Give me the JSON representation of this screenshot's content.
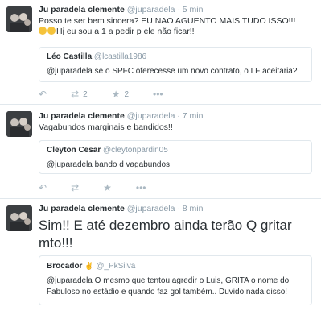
{
  "tweets": [
    {
      "author": "Ju paradela clemente",
      "handle": "@juparadela",
      "sep": "·",
      "time": "5 min",
      "text_line1": "Posso te ser bem sincera? EU NAO AGUENTO MAIS TUDO ISSO!!!",
      "text_line2": "Hj eu sou a 1 a pedir p ele não ficar!!",
      "quote": {
        "author": "Léo Castilla",
        "handle": "@lcastilla1986",
        "text": "@juparadela se o SPFC oferecesse um novo contrato, o LF aceitaria?"
      },
      "retweet_count": "2",
      "favorite_count": "2"
    },
    {
      "author": "Ju paradela clemente",
      "handle": "@juparadela",
      "sep": "·",
      "time": "7 min",
      "text_line1": "Vagabundos marginais e bandidos!!",
      "quote": {
        "author": "Cleyton Cesar",
        "handle": "@cleytonpardin05",
        "text": "@juparadela bando d vagabundos"
      }
    },
    {
      "author": "Ju paradela clemente",
      "handle": "@juparadela",
      "sep": "·",
      "time": "8 min",
      "text_line1": "Sim!! E até dezembro ainda terão Q gritar",
      "text_line2": "mto!!!",
      "quote": {
        "author": "Brocador",
        "handle": "@_PkSilva",
        "text_line1": "@juparadela O mesmo que tentou agredir o Luis, GRITA o nome do",
        "text_line2": "Fabuloso no estádio e quando faz gol também.. Duvido nada disso!"
      }
    }
  ],
  "icons": {
    "reply": "reply-icon",
    "retweet": "retweet-icon",
    "favorite": "star-icon",
    "more": "more-icon"
  },
  "colors": {
    "text": "#292f33",
    "muted": "#8899a6",
    "border": "#e1e8ed",
    "icon": "#aab8c2"
  }
}
